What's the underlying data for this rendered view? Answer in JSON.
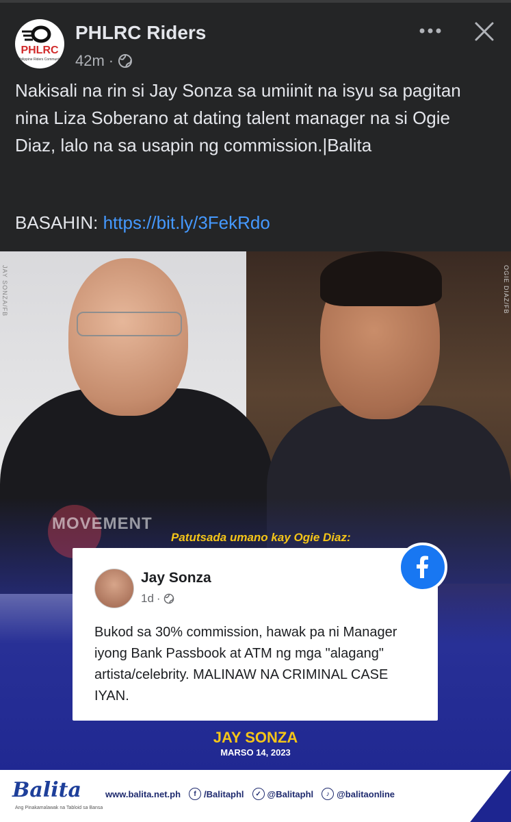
{
  "post": {
    "page_name": "PHLRC Riders",
    "avatar": {
      "logo_text": "PHLRC",
      "logo_sub": "Philippine Riders Community"
    },
    "time": "42m",
    "audience_icon": "globe-icon",
    "more_icon": "more-horizontal-icon",
    "close_icon": "close-icon",
    "body": "Nakisali na rin si Jay Sonza sa umiinit na isyu sa pagitan nina Liza Soberano at dating talent manager na si Ogie Diaz, lalo na sa usapin ng commission.|Balita",
    "read_label": "BASAHIN: ",
    "link": "https://bit.ly/3FekRdo"
  },
  "image": {
    "credit_left": "JAY SONZA/FB",
    "credit_right": "OGIE DIAZ/FB",
    "watermark": "MOVEMENT",
    "caption": "Patutsada umano kay Ogie Diaz:",
    "quote_card": {
      "name": "Jay Sonza",
      "time": "1d",
      "text": "Bukod sa 30% commission, hawak pa ni Manager iyong Bank Passbook at ATM ng mga \"alagang\" artista/celebrity. MALINAW NA CRIMINAL CASE IYAN."
    },
    "byline_name": "JAY SONZA",
    "byline_date": "MARSO 14, 2023",
    "footer": {
      "logo": "Balita",
      "tagline": "Ang Pinakamalawak na Tabloid sa Bansa",
      "website": "www.balita.net.ph",
      "facebook": "/Balitaphl",
      "twitter": "@Balitaphl",
      "tiktok": "@balitaonline"
    }
  },
  "colors": {
    "background": "#242526",
    "link": "#4599ff",
    "accent_yellow": "#f5c518",
    "fb_blue": "#1877f2"
  }
}
